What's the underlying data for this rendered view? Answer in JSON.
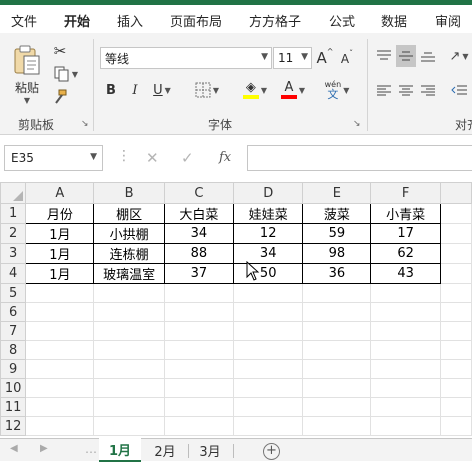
{
  "ribbon_tabs": [
    {
      "label": "文件"
    },
    {
      "label": "开始"
    },
    {
      "label": "插入"
    },
    {
      "label": "页面布局"
    },
    {
      "label": "方方格子"
    },
    {
      "label": "公式"
    },
    {
      "label": "数据"
    },
    {
      "label": "审阅"
    }
  ],
  "active_tab": "开始",
  "clipboard": {
    "paste_label": "粘贴",
    "group_label": "剪贴板"
  },
  "font": {
    "name": "等线",
    "size": "11",
    "bold": "B",
    "italic": "I",
    "underline": "U",
    "grow": "A",
    "shrink": "A",
    "font_color_letter": "A",
    "phonetic_top": "wén",
    "phonetic_bottom": "文",
    "group_label": "字体"
  },
  "alignment": {
    "group_label_partial": "对齐"
  },
  "colors": {
    "accent": "#217346",
    "highlight": "#ffff00",
    "font_color": "#ff0000"
  },
  "formula_bar": {
    "cell_ref": "E35",
    "fx_label": "fx",
    "value": ""
  },
  "columns": [
    "A",
    "B",
    "C",
    "D",
    "E",
    "F"
  ],
  "row_numbers": [
    "1",
    "2",
    "3",
    "4",
    "5",
    "6",
    "7",
    "8",
    "9",
    "10",
    "11",
    "12"
  ],
  "table": {
    "header": [
      "月份",
      "棚区",
      "大白菜",
      "娃娃菜",
      "菠菜",
      "小青菜"
    ],
    "rows": [
      [
        "1月",
        "小拱棚",
        "34",
        "12",
        "59",
        "17"
      ],
      [
        "1月",
        "连栋棚",
        "88",
        "34",
        "98",
        "62"
      ],
      [
        "1月",
        "玻璃温室",
        "37",
        "50",
        "36",
        "43"
      ]
    ]
  },
  "sheets": [
    {
      "label": "1月"
    },
    {
      "label": "2月"
    },
    {
      "label": "3月"
    }
  ],
  "active_sheet": "1月"
}
